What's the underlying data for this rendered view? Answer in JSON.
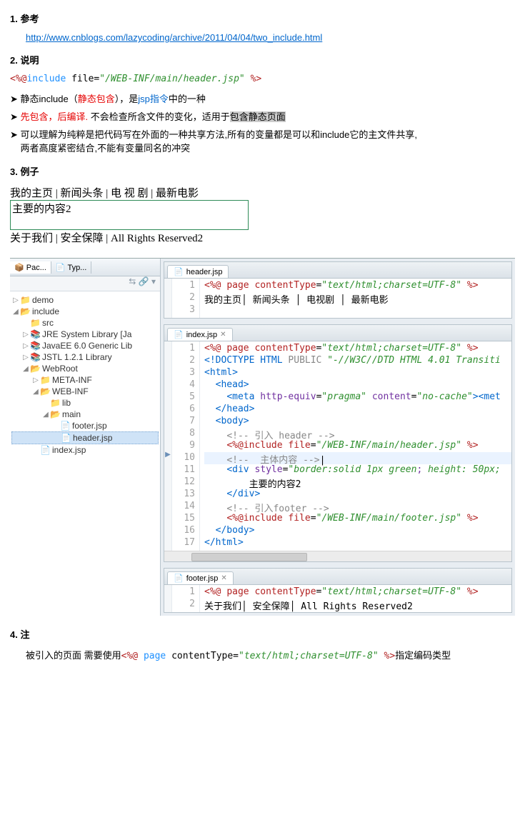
{
  "sections": {
    "s1": {
      "num": "1.",
      "title": "参考"
    },
    "s2": {
      "num": "2.",
      "title": "说明"
    },
    "s3": {
      "num": "3.",
      "title": "例子"
    },
    "s4": {
      "num": "4.",
      "title": "注"
    }
  },
  "ref_link": "http://www.cnblogs.com/lazycoding/archive/2011/04/04/two_include.html",
  "directive": {
    "open": "<%@",
    "kw": "include",
    "attr": "file=",
    "val": "\"/WEB-INF/main/header.jsp\"",
    "close": "%>"
  },
  "bullets": {
    "b1_a": "静态include（",
    "b1_red": "静态包含",
    "b1_b": "），是",
    "b1_blue": "jsp指令",
    "b1_c": "中的一种",
    "b2_red": "先包含，后编译.",
    "b2_a": " 不会检查所含文件的变化，适用于",
    "b2_hl": "包含静态页面",
    "b3_a": "可以理解为纯粹是把代码写在外面的一种共享方法,所有的变量都是可以和include它的主文件共享,",
    "b3_b": "两者高度紧密结合,不能有变量同名的冲突"
  },
  "demo": {
    "top": "我的主页  | 新闻头条  |  电  视  剧  | 最新电影",
    "mid": "主要的内容2",
    "bot": "关于我们  | 安全保障  | All Rights Reserved2"
  },
  "ide": {
    "lefttabs": {
      "pac": "Pac...",
      "typ": "Typ..."
    },
    "tree": [
      {
        "lvl": 0,
        "exp": "▷",
        "ico": "📁",
        "label": "demo"
      },
      {
        "lvl": 0,
        "exp": "◢",
        "ico": "📂",
        "label": "include"
      },
      {
        "lvl": 1,
        "exp": " ",
        "ico": "📁",
        "label": "src"
      },
      {
        "lvl": 1,
        "exp": "▷",
        "ico": "📚",
        "label": "JRE System Library [Ja"
      },
      {
        "lvl": 1,
        "exp": "▷",
        "ico": "📚",
        "label": "JavaEE 6.0 Generic Lib"
      },
      {
        "lvl": 1,
        "exp": "▷",
        "ico": "📚",
        "label": "JSTL 1.2.1 Library"
      },
      {
        "lvl": 1,
        "exp": "◢",
        "ico": "📂",
        "label": "WebRoot"
      },
      {
        "lvl": 2,
        "exp": "▷",
        "ico": "📁",
        "label": "META-INF"
      },
      {
        "lvl": 2,
        "exp": "◢",
        "ico": "📂",
        "label": "WEB-INF"
      },
      {
        "lvl": 3,
        "exp": " ",
        "ico": "📁",
        "label": "lib"
      },
      {
        "lvl": 3,
        "exp": "◢",
        "ico": "📂",
        "label": "main"
      },
      {
        "lvl": 4,
        "exp": " ",
        "ico": "📄",
        "label": "footer.jsp"
      },
      {
        "lvl": 4,
        "exp": " ",
        "ico": "📄",
        "label": "header.jsp",
        "sel": true
      },
      {
        "lvl": 2,
        "exp": " ",
        "ico": "📄",
        "label": "index.jsp"
      }
    ],
    "editors": {
      "header": {
        "tab": "header.jsp",
        "lines": [
          {
            "n": "1",
            "html": "<span class='tk-dir'>&lt;%@</span> <span class='tk-dir'>page</span> <span class='tk-dir'>contentType</span>=<span class='tk-str'>\"text/html;charset=UTF-8\"</span> <span class='tk-dir'>%&gt;</span>"
          },
          {
            "n": "2",
            "html": "我的主页│ 新闻头条 │ 电视剧 │ 最新电影"
          },
          {
            "n": "3",
            "html": ""
          }
        ]
      },
      "index": {
        "tab": "index.jsp",
        "lines": [
          {
            "n": "1",
            "html": "<span class='tk-dir'>&lt;%@</span> <span class='tk-dir'>page</span> <span class='tk-dir'>contentType</span>=<span class='tk-str'>\"text/html;charset=UTF-8\"</span> <span class='tk-dir'>%&gt;</span>"
          },
          {
            "n": "2",
            "html": "<span class='tk-blue'>&lt;!DOCTYPE</span> <span class='tk-blue'>HTML</span> <span class='tk-gray'>PUBLIC</span> <span class='tk-str'>\"-//W3C//DTD HTML 4.01 Transiti</span>"
          },
          {
            "n": "3",
            "html": "<span class='tk-blue'>&lt;html&gt;</span>"
          },
          {
            "n": "4",
            "html": "&nbsp;&nbsp;<span class='tk-blue'>&lt;head&gt;</span>"
          },
          {
            "n": "5",
            "html": "&nbsp;&nbsp;&nbsp;&nbsp;<span class='tk-blue'>&lt;meta</span> <span class='tk-purp'>http-equiv</span>=<span class='tk-str'>\"pragma\"</span> <span class='tk-purp'>content</span>=<span class='tk-str'>\"no-cache\"</span><span class='tk-blue'>&gt;&lt;met</span>"
          },
          {
            "n": "6",
            "html": "&nbsp;&nbsp;<span class='tk-blue'>&lt;/head&gt;</span>"
          },
          {
            "n": "7",
            "html": "&nbsp;&nbsp;<span class='tk-blue'>&lt;body&gt;</span>"
          },
          {
            "n": "8",
            "html": "&nbsp;&nbsp;&nbsp;&nbsp;<span class='tk-gray'>&lt;!-- 引入 header  --&gt;</span>"
          },
          {
            "n": "9",
            "html": "&nbsp;&nbsp;&nbsp;&nbsp;<span class='tk-dir'>&lt;%@include</span> <span class='tk-dir'>file</span>=<span class='tk-str'>\"/WEB-INF/main/header.jsp\"</span> <span class='tk-dir'>%&gt;</span>"
          },
          {
            "n": "10",
            "sel": true,
            "mark": "▶",
            "html": "&nbsp;&nbsp;&nbsp;&nbsp;<span class='tk-gray'>&lt;!-- &nbsp;主体内容 --&gt;</span>|"
          },
          {
            "n": "11",
            "html": "&nbsp;&nbsp;&nbsp;&nbsp;<span class='tk-blue'>&lt;div</span> <span class='tk-purp'>style</span>=<span class='tk-str'>\"border:solid 1px green</span><span class='tk-purp'>;</span> <span class='tk-str'>height: 50px;</span>"
          },
          {
            "n": "12",
            "html": "&nbsp;&nbsp;&nbsp;&nbsp;&nbsp;&nbsp;&nbsp;&nbsp;主要的内容2"
          },
          {
            "n": "13",
            "html": "&nbsp;&nbsp;&nbsp;&nbsp;<span class='tk-blue'>&lt;/div&gt;</span>"
          },
          {
            "n": "14",
            "html": "&nbsp;&nbsp;&nbsp;&nbsp;<span class='tk-gray'>&lt;!-- 引入footer --&gt;</span>"
          },
          {
            "n": "15",
            "html": "&nbsp;&nbsp;&nbsp;&nbsp;<span class='tk-dir'>&lt;%@include</span> <span class='tk-dir'>file</span>=<span class='tk-str'>\"/WEB-INF/main/footer.jsp\"</span> <span class='tk-dir'>%&gt;</span>"
          },
          {
            "n": "16",
            "html": "&nbsp;&nbsp;<span class='tk-blue'>&lt;/body&gt;</span>"
          },
          {
            "n": "17",
            "html": "<span class='tk-blue'>&lt;/html&gt;</span>"
          }
        ]
      },
      "footer": {
        "tab": "footer.jsp",
        "lines": [
          {
            "n": "1",
            "html": "<span class='tk-dir'>&lt;%@</span> <span class='tk-dir'>page</span> <span class='tk-dir'>contentType</span>=<span class='tk-str'>\"text/html;charset=UTF-8\"</span> <span class='tk-dir'>%&gt;</span>"
          },
          {
            "n": "2",
            "html": "关于我们│ 安全保障│ All Rights Reserved2"
          }
        ]
      }
    }
  },
  "note": {
    "pre": "被引入的页面 需要使用",
    "code": {
      "open": "<%@",
      "kw": "page",
      "attr": "contentType=",
      "val": "\"text/html;charset=UTF-8\"",
      "close": "%>"
    },
    "post": "指定编码类型"
  }
}
